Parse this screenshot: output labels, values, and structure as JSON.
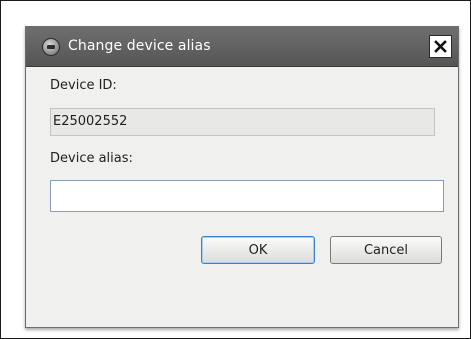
{
  "dialog": {
    "title": "Change device alias",
    "app_icon": "device-manager-icon",
    "close_icon": "close-icon",
    "close_glyph": "✕"
  },
  "form": {
    "device_id_label": "Device ID:",
    "device_id_value": "E25002552",
    "device_alias_label": "Device alias:",
    "device_alias_value": "",
    "device_alias_placeholder": ""
  },
  "buttons": {
    "ok_label": "OK",
    "cancel_label": "Cancel"
  },
  "colors": {
    "titlebar": "#555555",
    "dialog_background": "#f0f0ee",
    "default_button_border": "#3b7fd0"
  }
}
